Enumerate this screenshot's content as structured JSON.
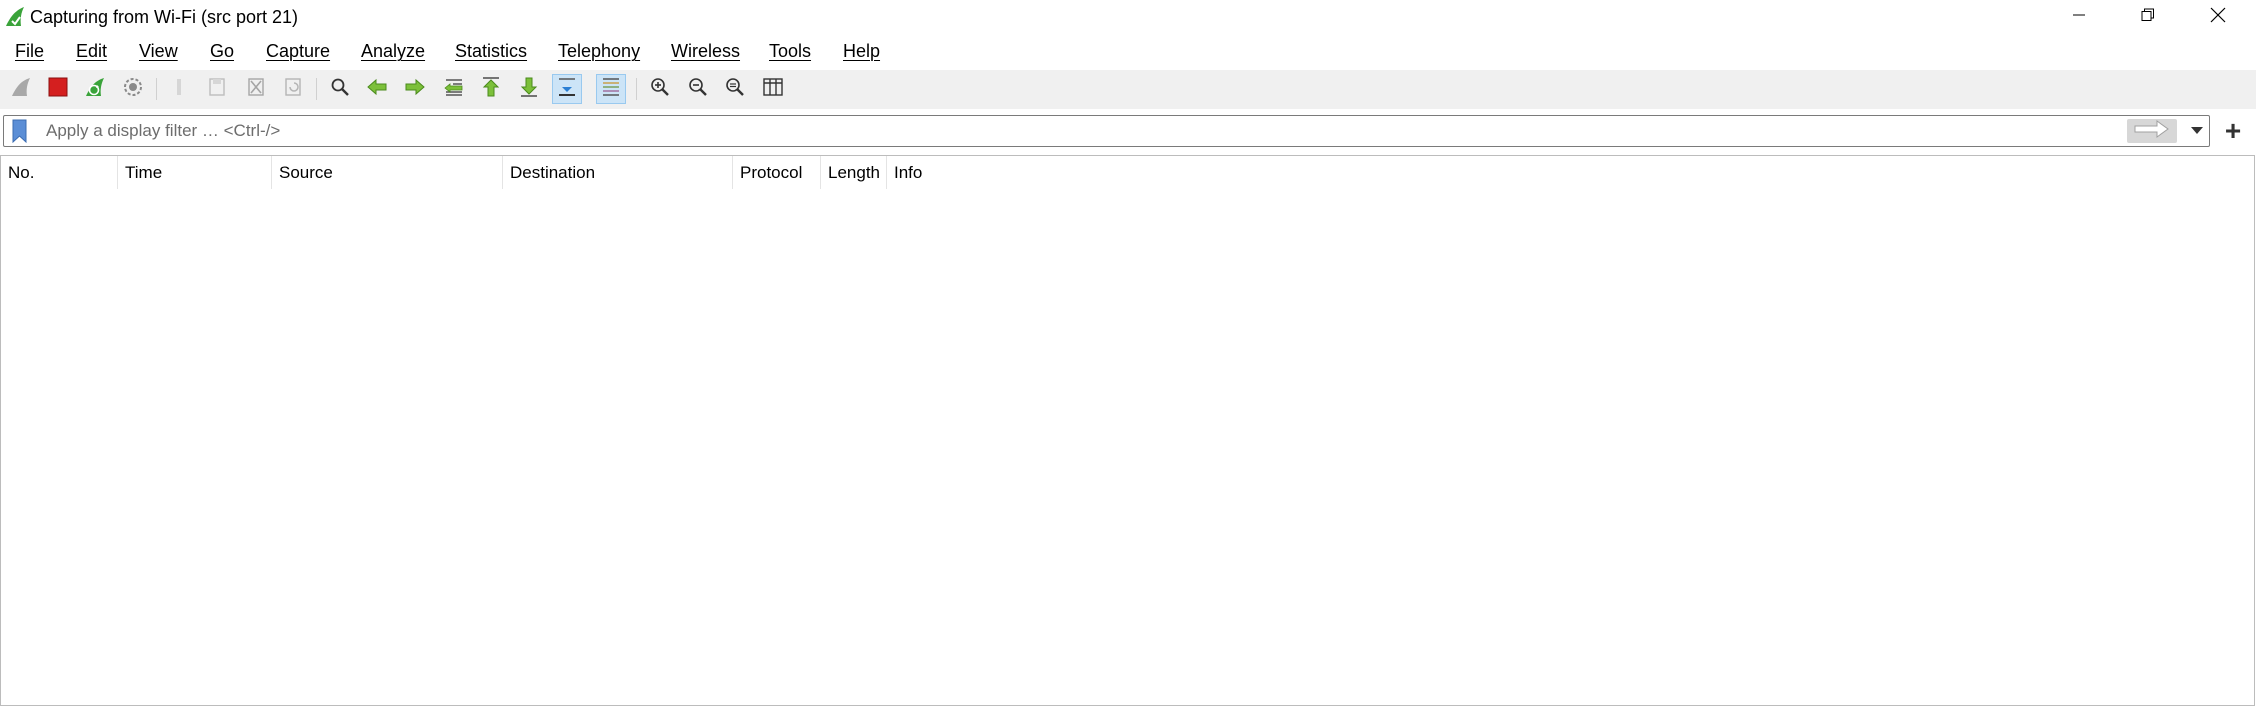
{
  "window": {
    "title": "Capturing from Wi-Fi (src port 21)",
    "icon": "wireshark-shark-fin-icon"
  },
  "menu": [
    "File",
    "Edit",
    "View",
    "Go",
    "Capture",
    "Analyze",
    "Statistics",
    "Telephony",
    "Wireless",
    "Tools",
    "Help"
  ],
  "toolbar": {
    "buttons": [
      "start-capture-icon",
      "stop-capture-icon",
      "restart-capture-icon",
      "capture-options-icon",
      "open-file-icon",
      "save-file-icon",
      "close-file-icon",
      "reload-file-icon",
      "find-packet-icon",
      "go-back-icon",
      "go-forward-icon",
      "go-to-packet-icon",
      "go-first-packet-icon",
      "go-last-packet-icon",
      "auto-scroll-icon",
      "colorize-icon",
      "zoom-in-icon",
      "zoom-out-icon",
      "normal-size-icon",
      "resize-columns-icon"
    ],
    "active": [
      "auto-scroll-icon",
      "colorize-icon"
    ]
  },
  "filter": {
    "placeholder": "Apply a display filter … <Ctrl-/>",
    "value": "",
    "apply_icon": "apply-filter-arrow-icon",
    "add_icon": "plus-icon",
    "add_label": "+"
  },
  "packet_list": {
    "columns": [
      "No.",
      "Time",
      "Source",
      "Destination",
      "Protocol",
      "Length",
      "Info"
    ],
    "rows": []
  },
  "colors": {
    "stop_red": "#d41f1f",
    "shark_green": "#3aa33a",
    "active_button_bg": "#cce4f7",
    "bookmark_blue": "#5b8ed6"
  }
}
